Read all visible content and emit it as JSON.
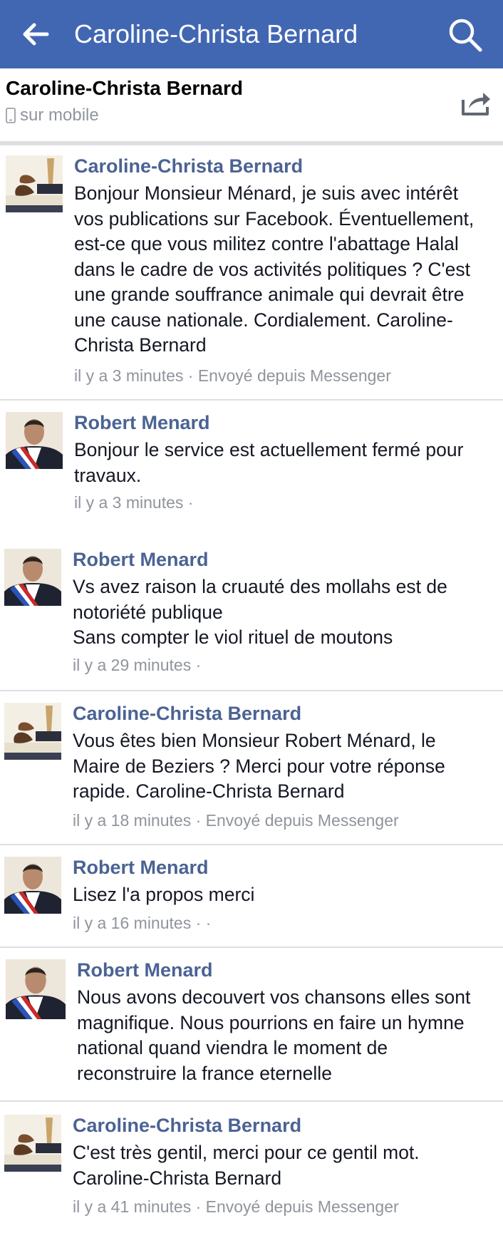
{
  "header": {
    "title": "Caroline-Christa Bernard",
    "back_icon": "arrow-left-icon",
    "search_icon": "search-icon",
    "background_color": "#4267b2"
  },
  "conversation": {
    "name": "Caroline-Christa Bernard",
    "status": "sur mobile",
    "status_icon": "mobile-phone-icon",
    "share_icon": "share-icon"
  },
  "messages": [
    {
      "sender": "Caroline-Christa Bernard",
      "text": "Bonjour Monsieur Ménard, je suis avec intérêt\nvos publications sur Facebook. Éventuellement,\nest-ce que vous militez contre l'abattage Halal\ndans le cadre de vos activités politiques ? C'est\nune grande souffrance animale qui devrait être\nune cause nationale. Cordialement. Caroline-\nChrista Bernard",
      "meta": "il y a 3 minutes · Envoyé depuis Messenger"
    },
    {
      "sender": "Robert Menard",
      "text": "Bonjour le service est actuellement fermé pour\ntravaux.",
      "meta": "il y a 3 minutes ·"
    },
    {
      "sender": "Robert Menard",
      "text": "Vs avez raison la cruauté des mollahs est de\nnotoriété publique\nSans compter le viol rituel de moutons",
      "meta": "il y a 29 minutes ·"
    },
    {
      "sender": "Caroline-Christa Bernard",
      "text": "Vous êtes bien Monsieur Robert Ménard, le\nMaire de Beziers ? Merci pour votre réponse\nrapide. Caroline-Christa Bernard",
      "meta": "il y a 18 minutes · Envoyé depuis Messenger"
    },
    {
      "sender": "Robert Menard",
      "text": "Lisez l'a propos merci",
      "meta": "il y a 16 minutes · ·"
    },
    {
      "sender": "Robert Menard",
      "text": "Nous avons decouvert vos chansons elles sont\nmagnifique. Nous pourrions en faire un hymne\nnational quand viendra le moment de\nreconstruire la france eternelle",
      "meta": ""
    },
    {
      "sender": "Caroline-Christa Bernard",
      "text": "C'est très gentil, merci pour ce gentil mot.\nCaroline-Christa Bernard",
      "meta": "il y a 41 minutes · Envoyé depuis Messenger"
    }
  ]
}
